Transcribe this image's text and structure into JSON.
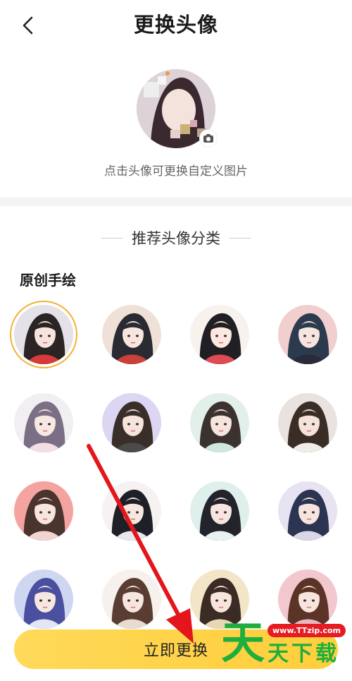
{
  "header": {
    "title": "更换头像"
  },
  "current_avatar": {
    "hint": "点击头像可更换自定义图片"
  },
  "recommend": {
    "section_title": "推荐头像分类",
    "category_title": "原创手绘",
    "avatars": [
      {
        "bg": "#e4e1e9",
        "hair": "#2b2424",
        "skin": "#f6e4dc",
        "cloth": "#d63a3a"
      },
      {
        "bg": "#efe1d7",
        "hair": "#2a2a33",
        "skin": "#f7e6dd",
        "cloth": "#c9413a"
      },
      {
        "bg": "#f7f2ee",
        "hair": "#1f1f24",
        "skin": "#fbe9e1",
        "cloth": "#e04a52"
      },
      {
        "bg": "#f1cfcf",
        "hair": "#2c3a4d",
        "skin": "#f6e5df",
        "cloth": "#2a2a3a"
      },
      {
        "bg": "#f2eff2",
        "hair": "#7b6f86",
        "skin": "#f7e8e1",
        "cloth": "#f3dfe3"
      },
      {
        "bg": "#dcd6f2",
        "hair": "#3a2e2a",
        "skin": "#f5e4dc",
        "cloth": "#4a4a4a"
      },
      {
        "bg": "#e3f0ea",
        "hair": "#3b3230",
        "skin": "#f6e5dd",
        "cloth": "#cfe7dc"
      },
      {
        "bg": "#e9e2df",
        "hair": "#3a2d26",
        "skin": "#f5e3da",
        "cloth": "#f0ece8"
      },
      {
        "bg": "#f4a3a0",
        "hair": "#4a342e",
        "skin": "#f8e6de",
        "cloth": "#f2d4d0"
      },
      {
        "bg": "#f6f2f2",
        "hair": "#1f1f27",
        "skin": "#f7e7e0",
        "cloth": "#e7e7ef"
      },
      {
        "bg": "#dff0ec",
        "hair": "#22232b",
        "skin": "#f7e6df",
        "cloth": "#e9f2f0"
      },
      {
        "bg": "#e8e3f2",
        "hair": "#2b3450",
        "skin": "#f5e5de",
        "cloth": "#d9d6e8"
      },
      {
        "bg": "#cfd6f1",
        "hair": "#4b4fa0",
        "skin": "#f7e7e1",
        "cloth": "#e3e6f5"
      },
      {
        "bg": "#f7f1ee",
        "hair": "#5a3d32",
        "skin": "#f7e6de",
        "cloth": "#e9dbd4"
      },
      {
        "bg": "#f3e6c8",
        "hair": "#3a2c24",
        "skin": "#f7e5dc",
        "cloth": "#e7d7b6"
      },
      {
        "bg": "#f2c7cd",
        "hair": "#5c3327",
        "skin": "#f7e4dc",
        "cloth": "#e7b7be"
      }
    ]
  },
  "action": {
    "confirm_label": "立即更换"
  },
  "watermark": {
    "url": "www.TTzip.com",
    "big_char": "天",
    "text": "天下载"
  },
  "colors": {
    "accent_yellow": "#ffd23f",
    "selected_ring": "#f2b234",
    "arrow_red": "#e3161c"
  },
  "icons": {
    "back": "chevron-left-icon",
    "camera": "camera-icon"
  }
}
